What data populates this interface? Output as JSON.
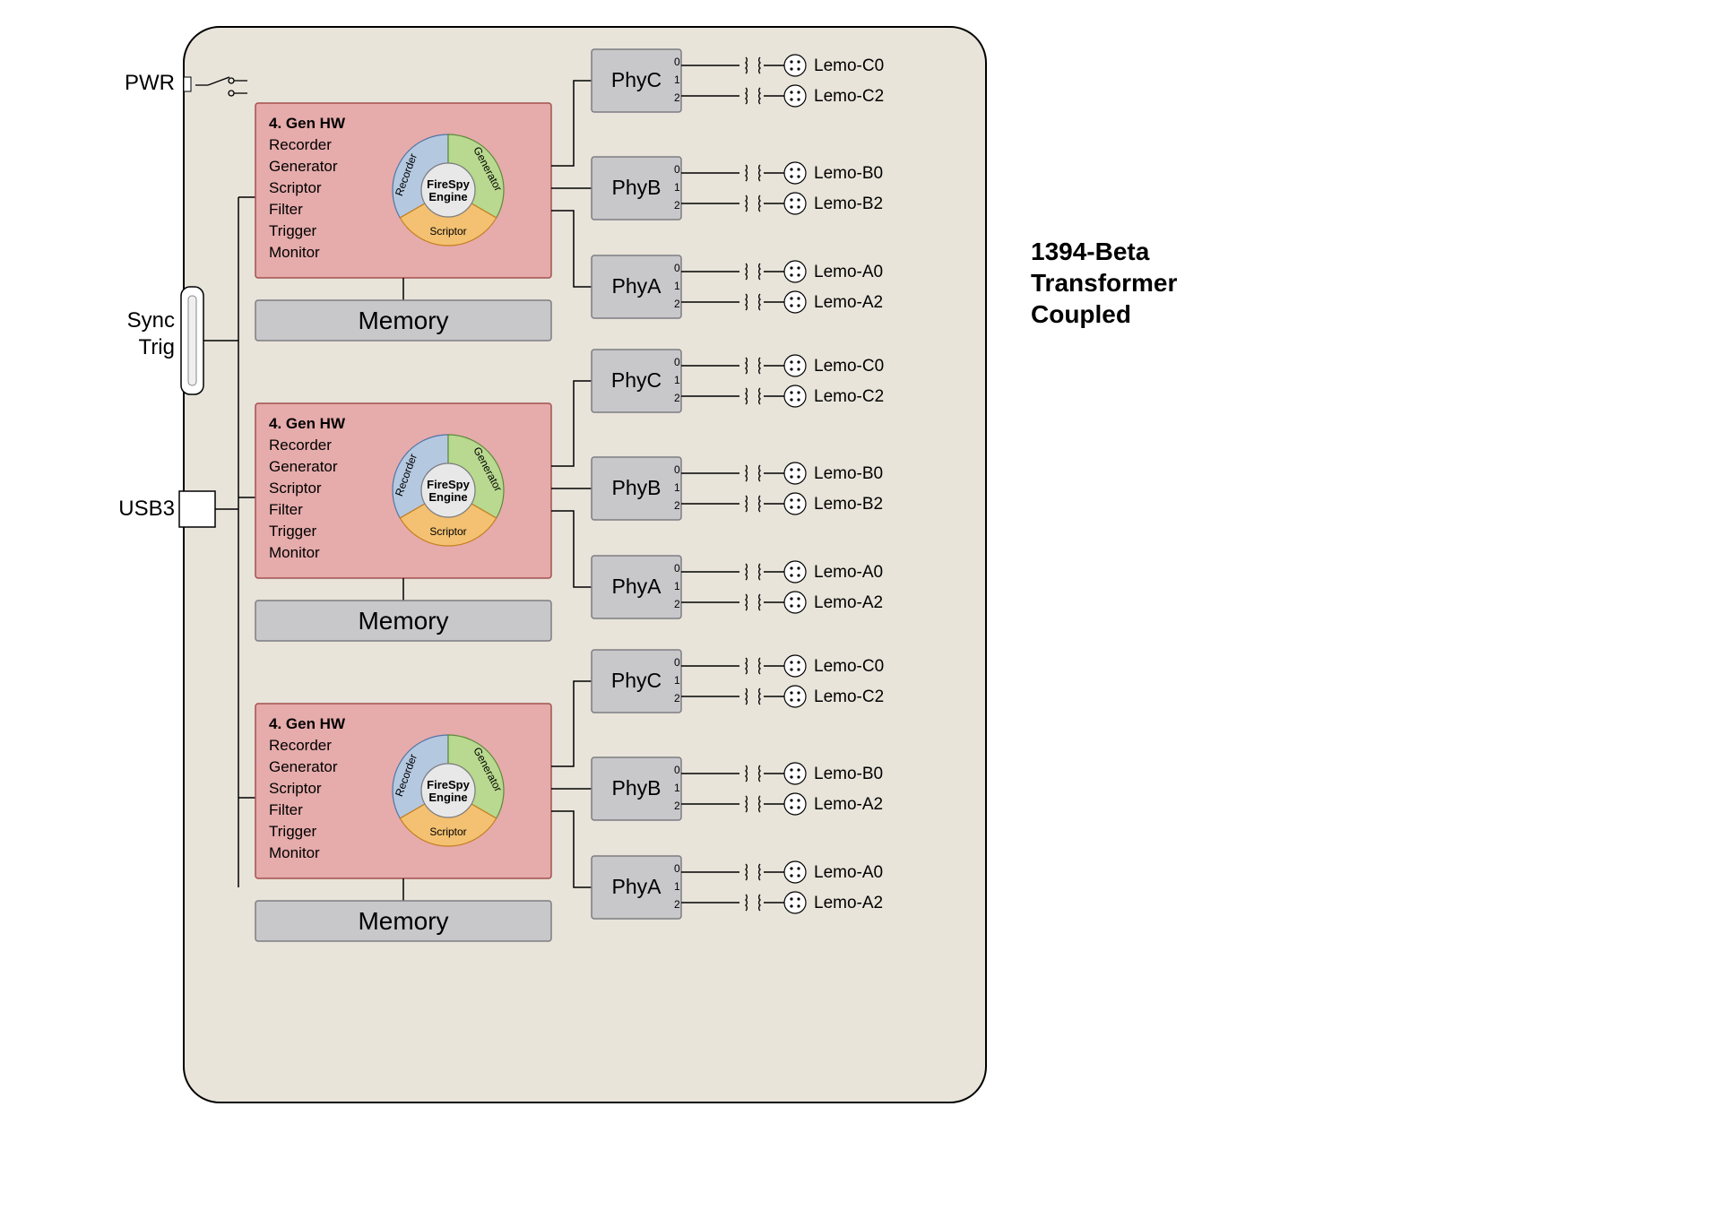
{
  "left_labels": {
    "pwr": "PWR",
    "sync": "Sync",
    "trig": "Trig",
    "usb3": "USB3"
  },
  "title": {
    "line1": "1394-Beta",
    "line2": "Transformer",
    "line3": "Coupled"
  },
  "engine": {
    "feature_title": "4. Gen HW",
    "features": [
      "Recorder",
      "Generator",
      "Scriptor",
      "Filter",
      "Trigger",
      "Monitor"
    ],
    "center1": "FireSpy",
    "center2": "Engine",
    "seg_blue": "Recorder",
    "seg_green": "Generator",
    "seg_orange": "Scriptor",
    "memory": "Memory"
  },
  "phy": {
    "c": "PhyC",
    "b": "PhyB",
    "a": "PhyA",
    "idx0": "0",
    "idx1": "1",
    "idx2": "2"
  },
  "groups": [
    {
      "lemo": [
        "Lemo-C0",
        "Lemo-C2",
        "Lemo-B0",
        "Lemo-B2",
        "Lemo-A0",
        "Lemo-A2"
      ]
    },
    {
      "lemo": [
        "Lemo-C0",
        "Lemo-C2",
        "Lemo-B0",
        "Lemo-B2",
        "Lemo-A0",
        "Lemo-A2"
      ]
    },
    {
      "lemo": [
        "Lemo-C0",
        "Lemo-C2",
        "Lemo-B0",
        "Lemo-A2",
        "Lemo-A0",
        "Lemo-A2"
      ]
    }
  ]
}
